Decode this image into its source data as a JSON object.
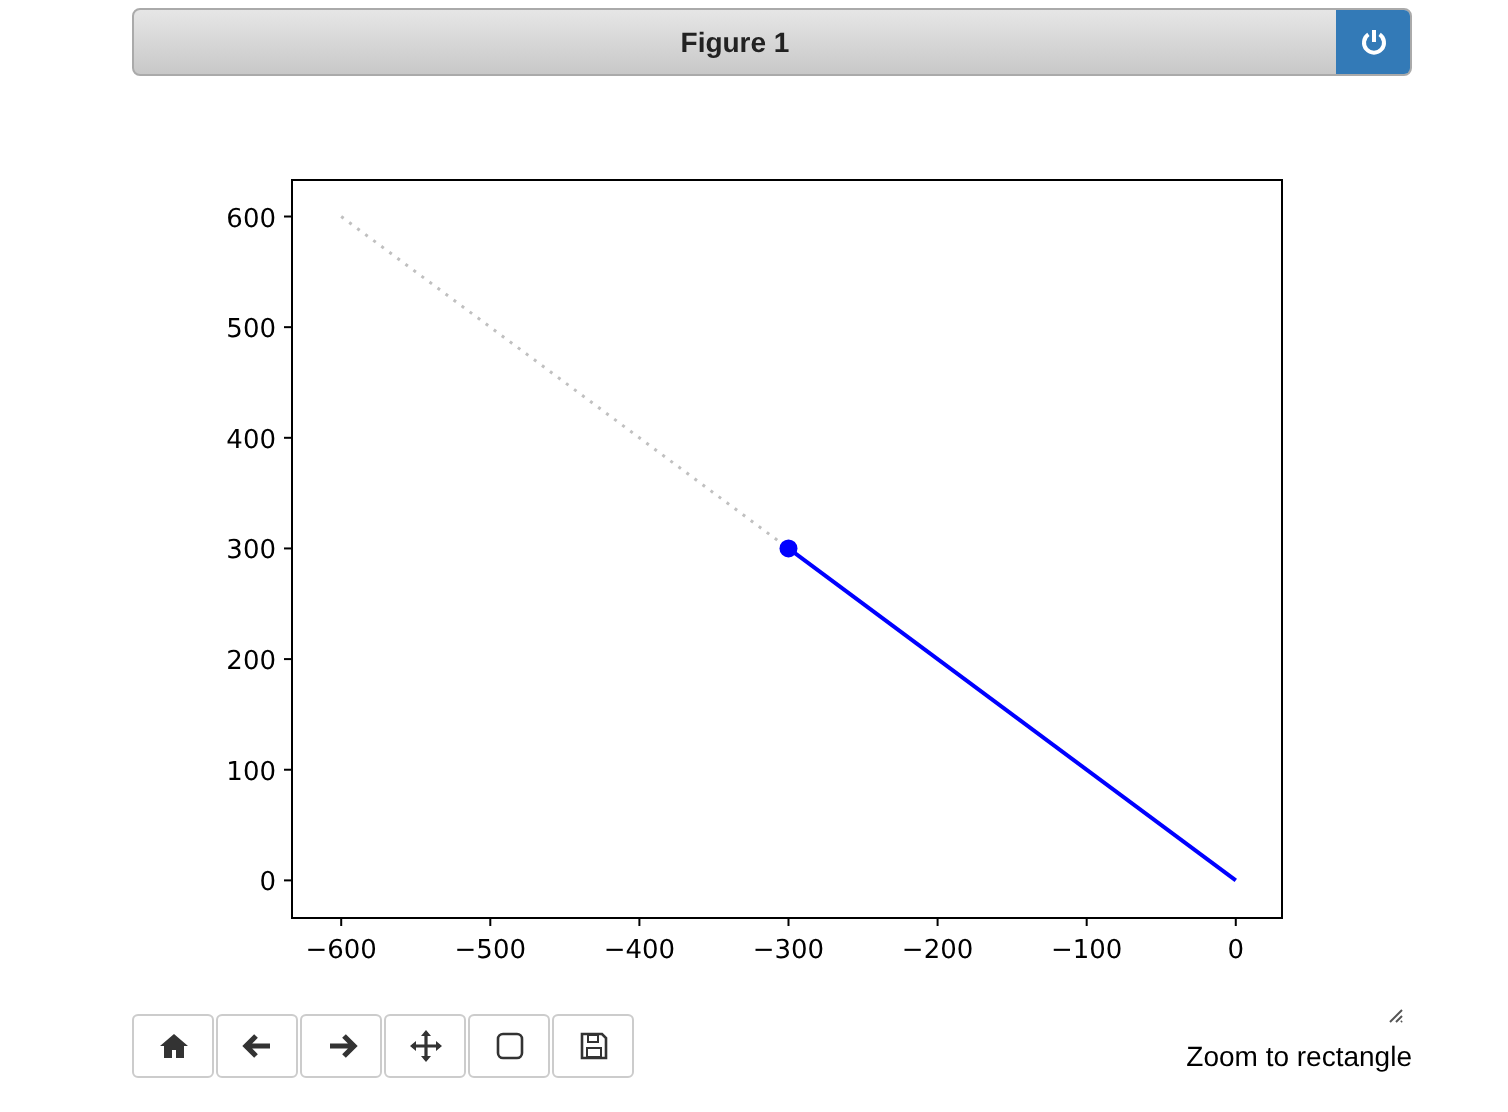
{
  "window": {
    "title": "Figure 1"
  },
  "chart_data": {
    "type": "line",
    "x": [
      -600,
      -300,
      0
    ],
    "xlim": [
      -633,
      31
    ],
    "ylim": [
      -34,
      633
    ],
    "xticks": [
      {
        "value": -600,
        "label": "−600"
      },
      {
        "value": -500,
        "label": "−500"
      },
      {
        "value": -400,
        "label": "−400"
      },
      {
        "value": -300,
        "label": "−300"
      },
      {
        "value": -200,
        "label": "−200"
      },
      {
        "value": -100,
        "label": "−100"
      },
      {
        "value": 0,
        "label": "0"
      }
    ],
    "yticks": [
      0,
      100,
      200,
      300,
      400,
      500,
      600
    ],
    "series": [
      {
        "line_style": "dotted",
        "color": "#c0c0c0",
        "values": [
          600,
          300,
          null
        ]
      },
      {
        "line_style": "solid",
        "color": "#0000ff",
        "values": [
          null,
          300,
          0
        ]
      },
      {
        "line_style": "none",
        "marker": "o",
        "color": "#0000ff",
        "values": [
          null,
          300,
          null
        ]
      }
    ]
  },
  "toolbar": [
    {
      "kind": "home"
    },
    {
      "kind": "back"
    },
    {
      "kind": "forward"
    },
    {
      "kind": "pan"
    },
    {
      "kind": "zoom"
    },
    {
      "kind": "save"
    }
  ],
  "message": "Zoom to rectangle"
}
